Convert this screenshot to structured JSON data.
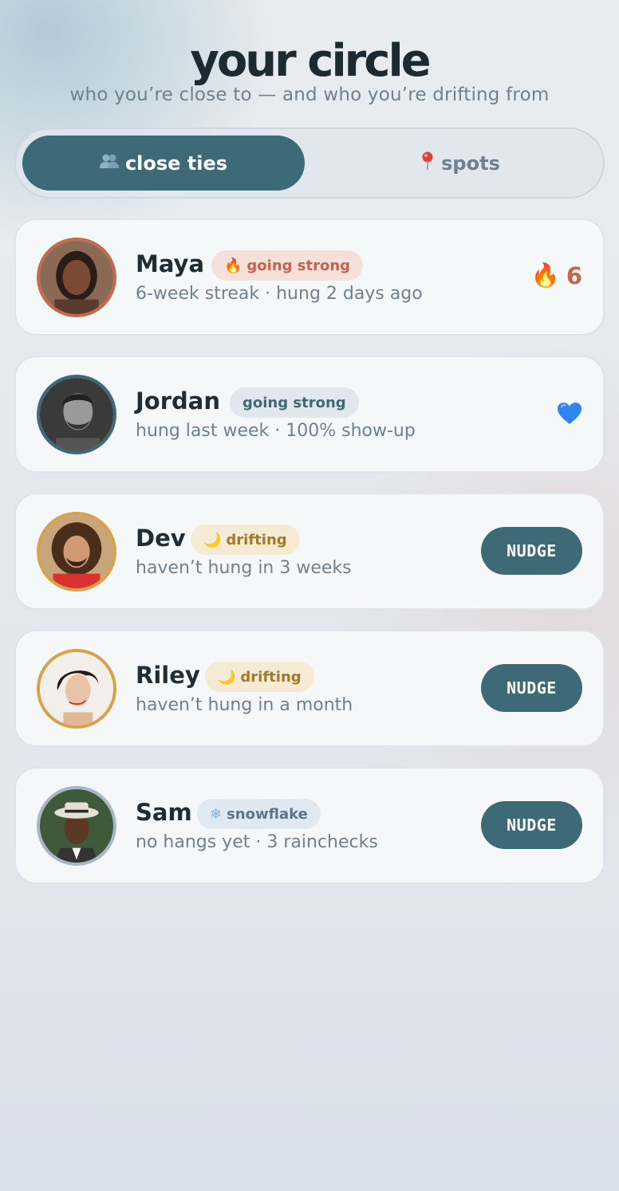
{
  "header": {
    "title": "your circle",
    "subtitle": "who you’re close to — and who you’re drifting from"
  },
  "tabs": [
    {
      "label": "close ties",
      "icon": "people-icon",
      "active": true
    },
    {
      "label": "spots",
      "icon": "pin-icon",
      "active": false
    }
  ],
  "friends": [
    {
      "name": "Maya",
      "badge": "going strong",
      "badge_icon": "🔥",
      "meta": "6-week streak · hung 2 days ago",
      "streak_icon": "🔥",
      "streak": "6",
      "ring_color": "#c4694d"
    },
    {
      "name": "Jordan",
      "badge": "going strong",
      "meta": "hung last week · 100% show-up",
      "status_icon": "blue-heart-icon",
      "ring_color": "#3e6977"
    },
    {
      "name": "Dev",
      "badge": "drifting",
      "badge_icon": "🌙",
      "meta": "haven’t hung in 3 weeks",
      "action": "NUDGE",
      "ring_color": "#d6a24c"
    },
    {
      "name": "Riley",
      "badge": "drifting",
      "badge_icon": "🌙",
      "meta": "haven’t hung in a month",
      "action": "NUDGE",
      "ring_color": "#d6a24c"
    },
    {
      "name": "Sam",
      "badge": "snowflake",
      "badge_icon": "❄",
      "meta": "no hangs yet · 3 rainchecks",
      "action": "NUDGE",
      "ring_color": "#a7b7c6"
    }
  ]
}
